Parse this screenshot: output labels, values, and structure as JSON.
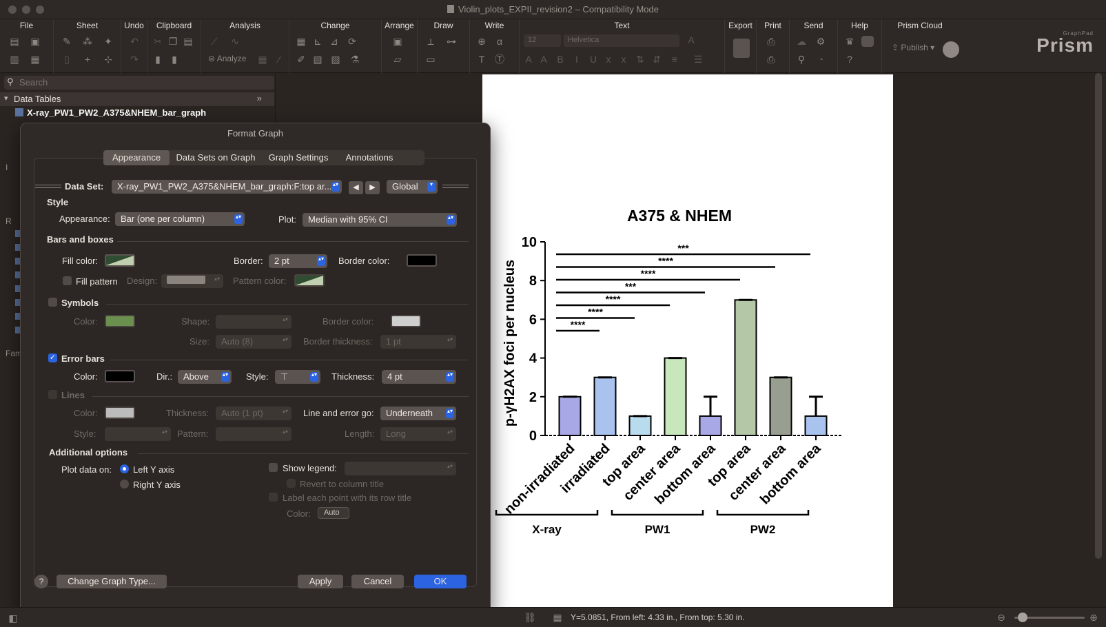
{
  "window": {
    "title": "Violin_plots_EXPII_revision2 – Compatibility Mode"
  },
  "toolbar": {
    "groups": [
      "File",
      "Sheet",
      "Undo",
      "Clipboard",
      "Analysis",
      "Change",
      "Arrange",
      "Draw",
      "Write",
      "Text",
      "Export",
      "Print",
      "Send",
      "Help",
      "Prism Cloud"
    ],
    "analyze_label": "Analyze",
    "font_size": "12",
    "font_name": "Helvetica",
    "publish_label": "Publish",
    "logo": "Prism",
    "logo_small": "GraphPad"
  },
  "sidebar": {
    "search_placeholder": "Search",
    "section": "Data Tables",
    "table_item": "X-ray_PW1_PW2_A375&NHEM_bar_graph",
    "letters": [
      "I",
      "R",
      "Fam"
    ]
  },
  "dialog": {
    "title": "Format Graph",
    "tabs": [
      "Appearance",
      "Data Sets on Graph",
      "Graph Settings",
      "Annotations"
    ],
    "dataset_label": "Data Set:",
    "dataset_value": "X-ray_PW1_PW2_A375&NHEM_bar_graph:F:top ar...",
    "scope_value": "Global",
    "style_heading": "Style",
    "appearance_label": "Appearance:",
    "appearance_value": "Bar (one per column)",
    "plot_label": "Plot:",
    "plot_value": "Median with 95% CI",
    "bars_heading": "Bars and boxes",
    "fill_color_label": "Fill color:",
    "border_label": "Border:",
    "border_value": "2 pt",
    "border_color_label": "Border color:",
    "fill_pattern_label": "Fill pattern",
    "design_label": "Design:",
    "pattern_color_label": "Pattern color:",
    "symbols_heading": "Symbols",
    "sym_color_label": "Color:",
    "shape_label": "Shape:",
    "sym_border_color_label": "Border color:",
    "size_label": "Size:",
    "size_value": "Auto (8)",
    "border_thickness_label": "Border thickness:",
    "border_thickness_value": "1 pt",
    "error_bars_heading": "Error bars",
    "eb_color_label": "Color:",
    "dir_label": "Dir.:",
    "dir_value": "Above",
    "style_label": "Style:",
    "thickness_label": "Thickness:",
    "thickness_value": "4 pt",
    "lines_heading": "Lines",
    "lines_color_label": "Color:",
    "lines_thickness_label": "Thickness:",
    "lines_thickness_value": "Auto (1 pt)",
    "line_error_label": "Line and error go:",
    "line_error_value": "Underneath",
    "lines_style_label": "Style:",
    "pattern_label": "Pattern:",
    "length_label": "Length:",
    "length_value": "Long",
    "additional_heading": "Additional options",
    "plot_data_on_label": "Plot data on:",
    "left_y": "Left Y axis",
    "right_y": "Right Y axis",
    "show_legend_label": "Show legend:",
    "revert_label": "Revert to column title",
    "label_rows_label": "Label each point with its row title",
    "label_color_label": "Color:",
    "label_color_value": "Auto",
    "change_type_button": "Change Graph Type...",
    "apply_button": "Apply",
    "cancel_button": "Cancel",
    "ok_button": "OK",
    "help_button": "?"
  },
  "colors": {
    "fill_swatch_a": "#314d31",
    "fill_swatch_b": "#c0cfb0",
    "border_color": "#000000",
    "symbol_color": "#6b8f4e",
    "symbol_border": "#cfcfcf",
    "error_color": "#000000",
    "lines_color": "#bcbcbc",
    "accent": "#2b63e0"
  },
  "chart_data": {
    "type": "bar",
    "title": "A375 & NHEM",
    "ylabel": "p-γH2AX foci per nucleus",
    "ylim": [
      0,
      10
    ],
    "yticks": [
      "0",
      "2",
      "4",
      "6",
      "8",
      "10"
    ],
    "categories": [
      "non-irradiated",
      "irradiated",
      "top area",
      "center area",
      "bottom area",
      "top area",
      "center area",
      "bottom area"
    ],
    "values": [
      2,
      3,
      1,
      4,
      1,
      7,
      3,
      1
    ],
    "error_upper": [
      2,
      3,
      1,
      4,
      2,
      7,
      3,
      2
    ],
    "bar_colors": [
      "#a8a8e6",
      "#a9c2ee",
      "#b8dcee",
      "#c8e8bc",
      "#a8a8e6",
      "#b4c8a8",
      "#999f90",
      "#a9c2ee"
    ],
    "groups": [
      {
        "label": "X-ray",
        "from": 0,
        "to": 1
      },
      {
        "label": "PW1",
        "from": 2,
        "to": 4
      },
      {
        "label": "PW2",
        "from": 5,
        "to": 7
      }
    ],
    "significance": [
      {
        "from": 0,
        "to": 1,
        "label": "****"
      },
      {
        "from": 0,
        "to": 2,
        "label": "****"
      },
      {
        "from": 0,
        "to": 3,
        "label": "****"
      },
      {
        "from": 0,
        "to": 4,
        "label": "***"
      },
      {
        "from": 0,
        "to": 5,
        "label": "****"
      },
      {
        "from": 0,
        "to": 6,
        "label": "****"
      },
      {
        "from": 0,
        "to": 7,
        "label": "***"
      }
    ]
  },
  "status": {
    "text": "Y=5.0851, From left: 4.33 in., From top: 5.30 in."
  }
}
